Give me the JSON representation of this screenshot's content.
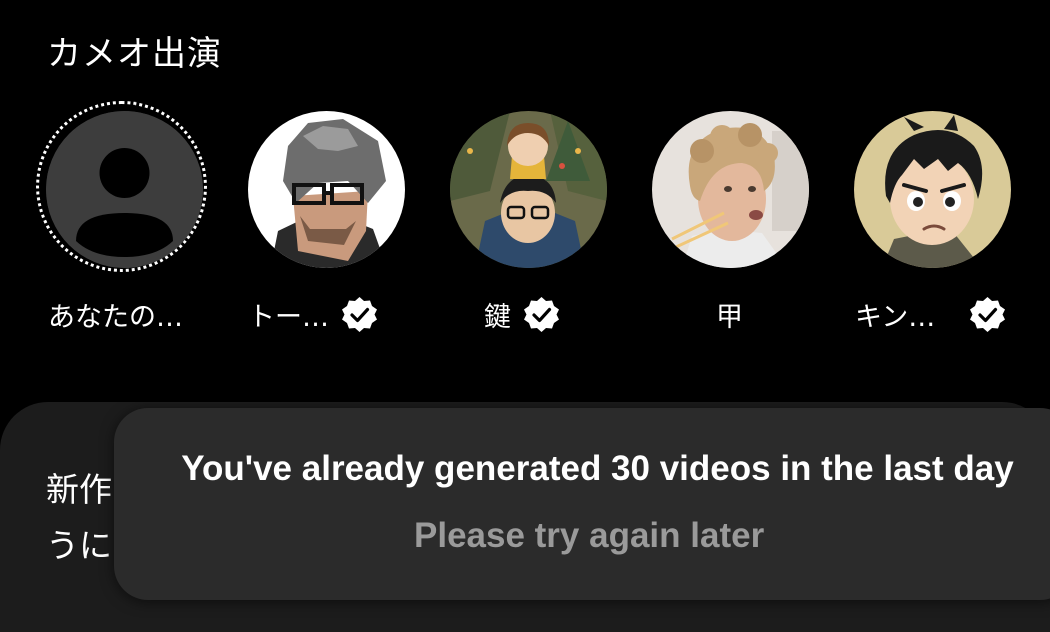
{
  "section": {
    "title": "カメオ出演"
  },
  "cameos": [
    {
      "name": "あなたの…",
      "verified": false,
      "avatar_icon": "default-user-icon"
    },
    {
      "name": "トー…",
      "verified": true,
      "avatar_icon": "pixel-art-portrait"
    },
    {
      "name": "鍵",
      "verified": true,
      "avatar_icon": "anime-father-child-portrait"
    },
    {
      "name": "甲",
      "verified": false,
      "avatar_icon": "curly-hair-man-portrait"
    },
    {
      "name": "キン…",
      "verified": true,
      "avatar_icon": "anime-boy-portrait"
    }
  ],
  "card": {
    "text": "新作\nうに"
  },
  "toast": {
    "title": "You've already generated 30 videos in the last day",
    "subtitle": "Please try again later"
  },
  "colors": {
    "background": "#000000",
    "card": "#1c1c1c",
    "toast": "#2b2b2b",
    "subtitle": "#9a9a9a"
  }
}
